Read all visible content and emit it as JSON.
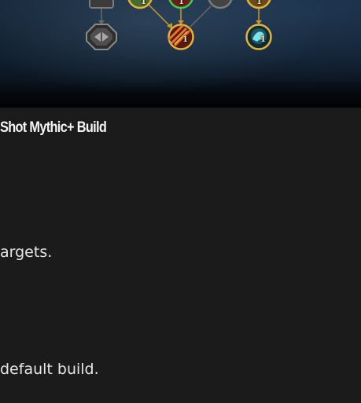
{
  "talent_tree": {
    "nodes": [
      {
        "id": "node-a",
        "kind": "octagon-choice",
        "state": "inactive",
        "icon": "arrows-icon",
        "rank": ""
      },
      {
        "id": "node-b",
        "kind": "circle",
        "state": "selected",
        "icon": "fire-arrow-icon",
        "rank": "1"
      },
      {
        "id": "node-c",
        "kind": "circle",
        "state": "selected",
        "icon": "frost-beast-icon",
        "rank": "1"
      },
      {
        "id": "node-top-1",
        "kind": "circle",
        "state": "selected",
        "rank": "1"
      },
      {
        "id": "node-top-2",
        "kind": "circle",
        "state": "active",
        "rank": "1"
      },
      {
        "id": "node-top-3",
        "kind": "circle",
        "state": "inactive",
        "rank": ""
      },
      {
        "id": "node-top-4",
        "kind": "circle",
        "state": "selected",
        "rank": "1"
      }
    ],
    "colors": {
      "selected_border": "#e2b33a",
      "active_border": "#3fce4a",
      "inactive_border": "#7b7b7b",
      "connector_selected": "#c89a2e",
      "connector_inactive": "#6a6a6a"
    }
  },
  "content": {
    "heading": "Shot Mythic+ Build",
    "line1": "argets.",
    "line2": "default build."
  }
}
